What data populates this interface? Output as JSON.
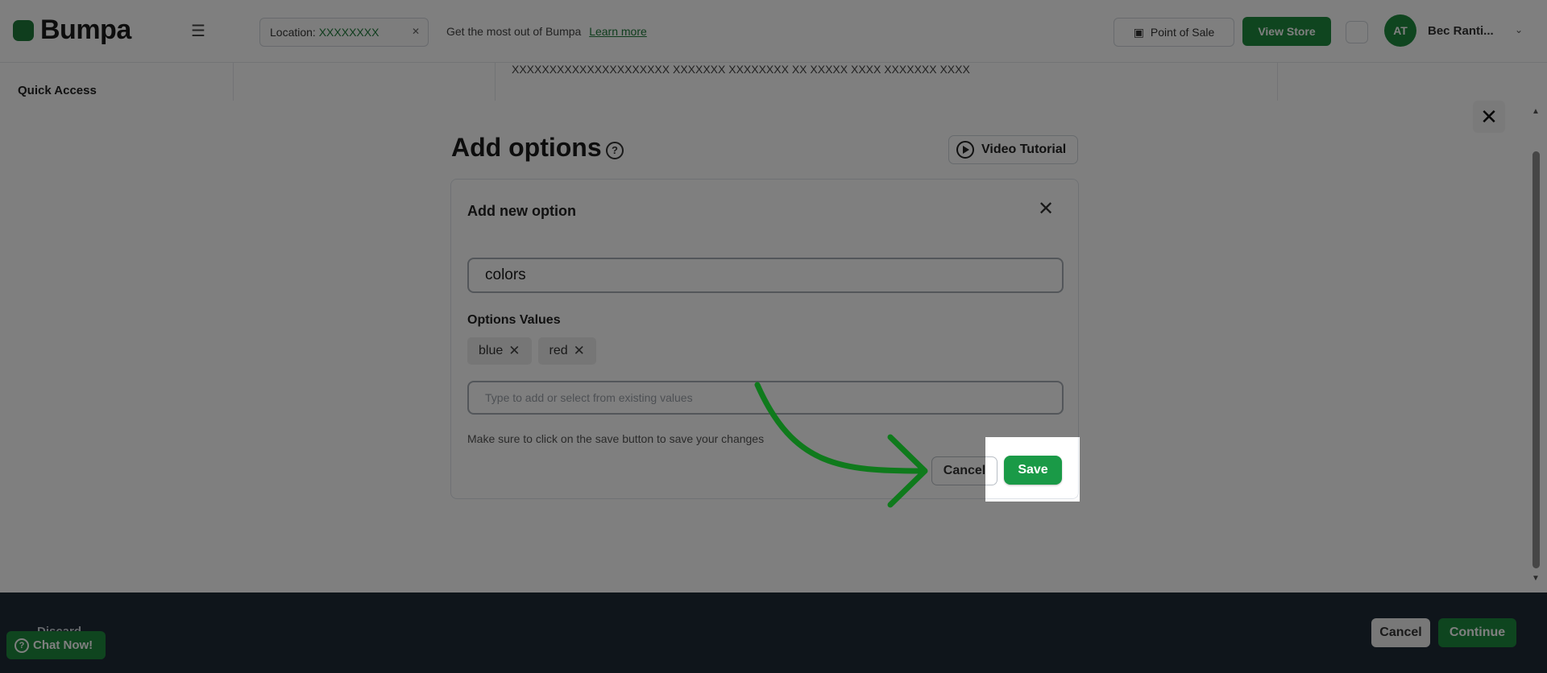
{
  "app": {
    "brand": "Bumpa",
    "location_label": "Location:",
    "location_value": "XXXXXXXX",
    "promo_text": "Get the most out of Bumpa",
    "promo_link": "Learn more",
    "pos_label": "Point of Sale",
    "view_store_label": "View Store",
    "avatar_initials": "AT",
    "user_name": "Bec Ranti...",
    "sidebar_heading": "Quick Access",
    "content_snippet": "XXXXXXXXXXXXXXXXXXXXX XXXXXXX XXXXXXXX XX XXXXX XXXX XXXXXXX XXXX"
  },
  "modal": {
    "title": "Add options",
    "video_tutorial_label": "Video Tutorial",
    "card": {
      "title": "Add new option",
      "option_name_value": "colors",
      "values_label": "Options Values",
      "tags": [
        {
          "label": "blue"
        },
        {
          "label": "red"
        }
      ],
      "value_placeholder": "Type to add or select from existing values",
      "hint": "Make sure to click on the save button to save your changes",
      "cancel_label": "Cancel",
      "save_label": "Save"
    }
  },
  "footer": {
    "discard_label": "Discard",
    "cancel_label": "Cancel",
    "continue_label": "Continue",
    "chat_label": "Chat Now!"
  },
  "icons": {
    "close": "close-icon",
    "help": "help-icon",
    "play": "play-circle-icon",
    "remove": "remove-icon",
    "menu": "menu-icon",
    "chevron": "chevron-down-icon"
  },
  "colors": {
    "primary_green": "#1a9a47",
    "dark_footer": "#1e2a36",
    "overlay_dim": "rgba(0,0,0,0.5)",
    "arrow_green": "#0f7a1c"
  }
}
